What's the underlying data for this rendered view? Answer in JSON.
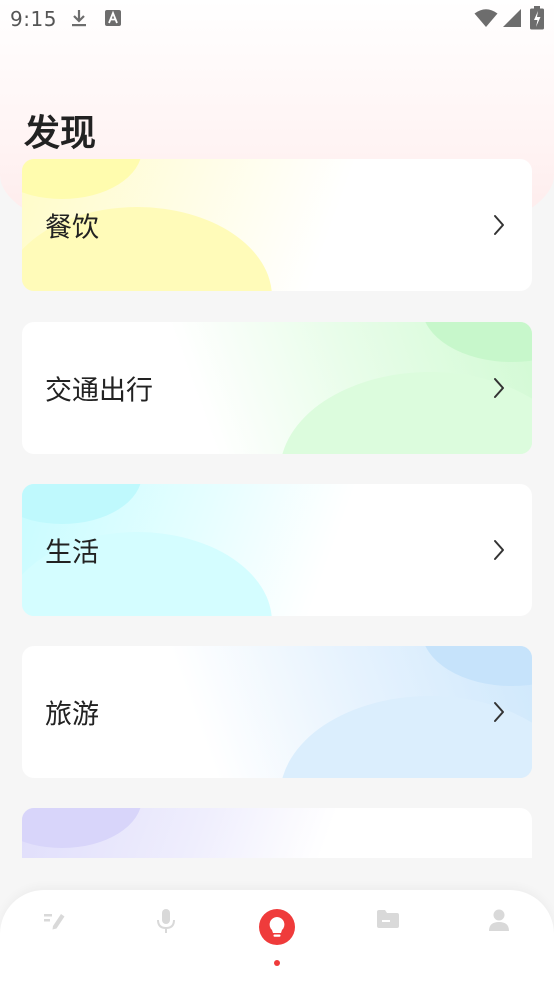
{
  "status_bar": {
    "time": "9:15",
    "left_icons": [
      "download-icon",
      "a-letter-icon"
    ],
    "right_icons": [
      "wifi-icon",
      "signal-icon",
      "battery-charging-icon"
    ]
  },
  "page": {
    "title": "发现"
  },
  "categories": [
    {
      "label": "餐饮",
      "accent": "#fffcc8"
    },
    {
      "label": "交通出行",
      "accent": "#d2fad4"
    },
    {
      "label": "生活",
      "accent": "#d2fcff"
    },
    {
      "label": "旅游",
      "accent": "#d6ecfd"
    },
    {
      "label": "",
      "accent": "#e3e1fb"
    }
  ],
  "tab_bar": {
    "tabs": [
      {
        "icon": "pen-icon",
        "active": false
      },
      {
        "icon": "microphone-icon",
        "active": false
      },
      {
        "icon": "lightbulb-icon",
        "active": true
      },
      {
        "icon": "folder-icon",
        "active": false
      },
      {
        "icon": "person-icon",
        "active": false
      }
    ],
    "active_color": "#ef3b3b",
    "inactive_color": "#d9d9d9"
  }
}
